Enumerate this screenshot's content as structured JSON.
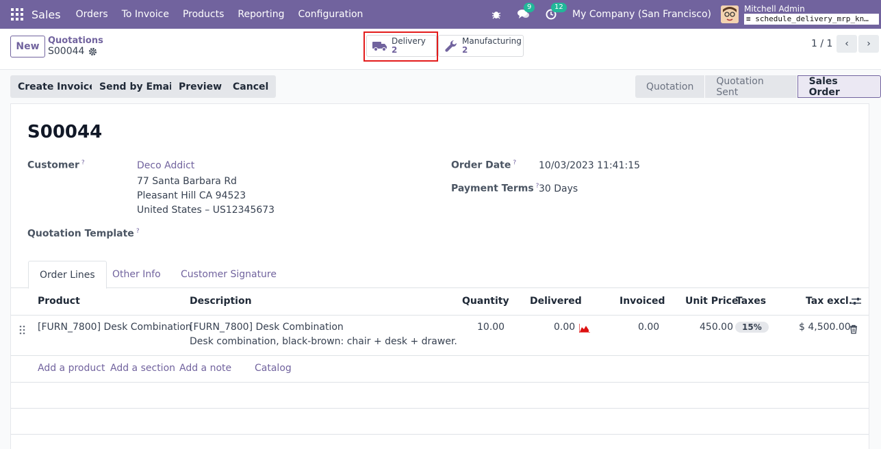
{
  "navbar": {
    "app_name": "Sales",
    "menu": [
      "Orders",
      "To Invoice",
      "Products",
      "Reporting",
      "Configuration"
    ],
    "chat_count": "9",
    "activity_count": "12",
    "company": "My Company (San Francisco)",
    "user_name": "Mitchell Admin",
    "db_name": "schedule_delivery_mrp_kn…",
    "bg_color": "#71639e"
  },
  "control": {
    "new_label": "New",
    "breadcrumb_parent": "Quotations",
    "breadcrumb_current": "S00044",
    "smart_buttons": [
      {
        "label": "Delivery",
        "value": "2",
        "icon": "truck-icon"
      },
      {
        "label": "Manufacturing",
        "value": "2",
        "icon": "wrench-icon"
      }
    ],
    "pager": "1 / 1"
  },
  "actions": {
    "create_invoice": "Create Invoice",
    "send_email": "Send by Email",
    "preview": "Preview",
    "cancel": "Cancel"
  },
  "status": {
    "stages": [
      "Quotation",
      "Quotation Sent",
      "Sales Order"
    ],
    "active": "Sales Order"
  },
  "form": {
    "title": "S00044",
    "customer_label": "Customer",
    "customer_name": "Deco Addict",
    "address_line1": "77 Santa Barbara Rd",
    "address_line2": "Pleasant Hill CA 94523",
    "address_line3": "United States – US12345673",
    "template_label": "Quotation Template",
    "order_date_label": "Order Date",
    "order_date": "10/03/2023 11:41:15",
    "payment_terms_label": "Payment Terms",
    "payment_terms": "30 Days",
    "help_mark": "?"
  },
  "tabs": [
    "Order Lines",
    "Other Info",
    "Customer Signature"
  ],
  "table": {
    "headers": {
      "product": "Product",
      "description": "Description",
      "quantity": "Quantity",
      "delivered": "Delivered",
      "invoiced": "Invoiced",
      "unit_price": "Unit Price",
      "taxes": "Taxes",
      "tax_excl": "Tax excl."
    },
    "rows": [
      {
        "product": "[FURN_7800] Desk Combination",
        "description": "[FURN_7800] Desk Combination",
        "description_detail": "Desk combination, black-brown: chair + desk + drawer.",
        "quantity": "10.00",
        "delivered": "0.00",
        "invoiced": "0.00",
        "unit_price": "450.00",
        "taxes": "15%",
        "tax_excl": "$ 4,500.00"
      }
    ],
    "add_links": [
      "Add a product",
      "Add a section",
      "Add a note",
      "Catalog"
    ]
  }
}
